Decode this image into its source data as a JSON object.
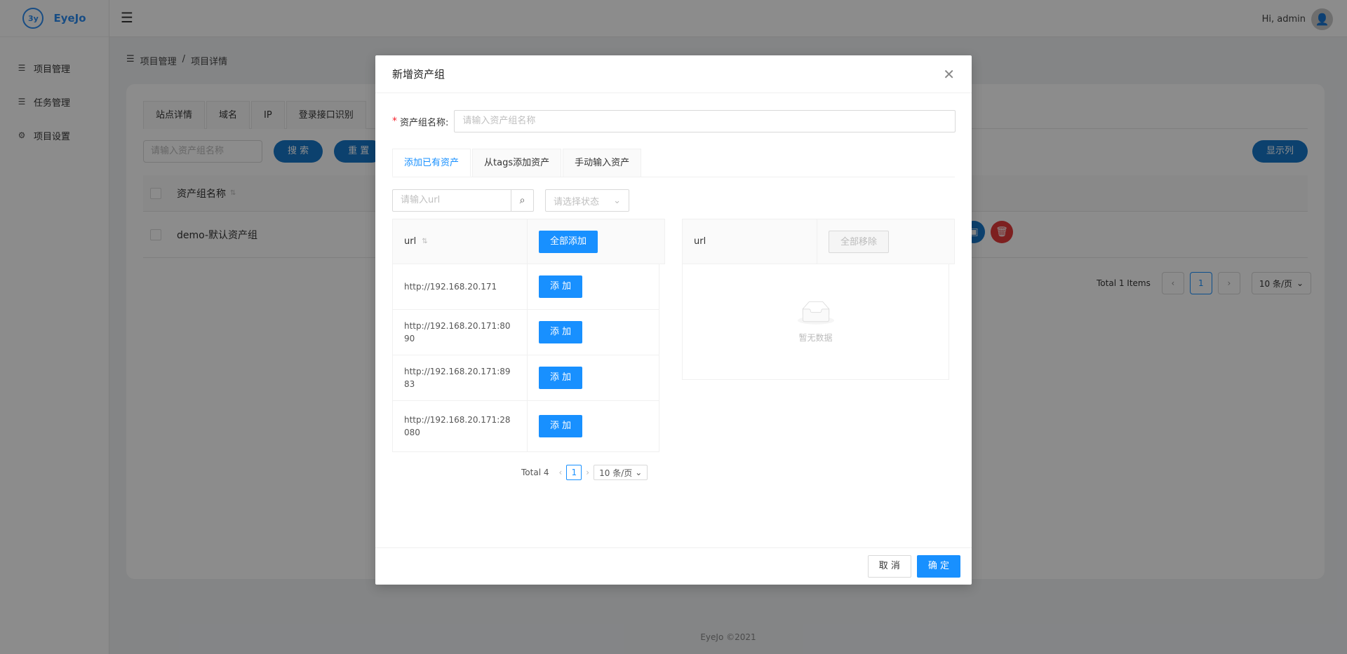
{
  "app": {
    "logo_mark": "3y",
    "name": "EyeJo",
    "user_greeting": "Hi, admin"
  },
  "sidebar": {
    "items": [
      {
        "label": "项目管理",
        "icon": "list-icon"
      },
      {
        "label": "任务管理",
        "icon": "list-icon"
      },
      {
        "label": "项目设置",
        "icon": "gear-icon"
      }
    ]
  },
  "breadcrumb": {
    "root": "项目管理",
    "sep": "/",
    "current": "项目详情"
  },
  "page": {
    "tabs": [
      "站点详情",
      "域名",
      "IP",
      "登录接口识别"
    ],
    "search_placeholder": "请输入资产组名称",
    "search_btn": "搜 索",
    "reset_btn": "重 置",
    "show_columns_btn": "显示列",
    "table": {
      "header": "资产组名称",
      "rows": [
        "demo-默认资产组"
      ]
    },
    "pagination": {
      "total": "Total 1 Items",
      "page": "1",
      "size": "10 条/页"
    }
  },
  "footer": "EyeJo ©2021",
  "modal": {
    "title": "新增资产组",
    "name_label": "资产组名称:",
    "name_placeholder": "请输入资产组名称",
    "tabs": [
      "添加已有资产",
      "从tags添加资产",
      "手动输入资产"
    ],
    "url_placeholder": "请输入url",
    "status_placeholder": "请选择状态",
    "left_table": {
      "col_url": "url",
      "add_all_btn": "全部添加",
      "rows": [
        {
          "url": "http://192.168.20.171",
          "btn": "添 加"
        },
        {
          "url": "http://192.168.20.171:8090",
          "btn": "添 加"
        },
        {
          "url": "http://192.168.20.171:8983",
          "btn": "添 加"
        },
        {
          "url": "http://192.168.20.171:28080",
          "btn": "添 加"
        }
      ]
    },
    "inner_pagination": {
      "total": "Total 4",
      "page": "1",
      "size": "10 条/页"
    },
    "right_table": {
      "col_url": "url",
      "remove_all_btn": "全部移除",
      "empty_text": "暂无数据"
    },
    "cancel_btn": "取 消",
    "ok_btn": "确 定"
  }
}
